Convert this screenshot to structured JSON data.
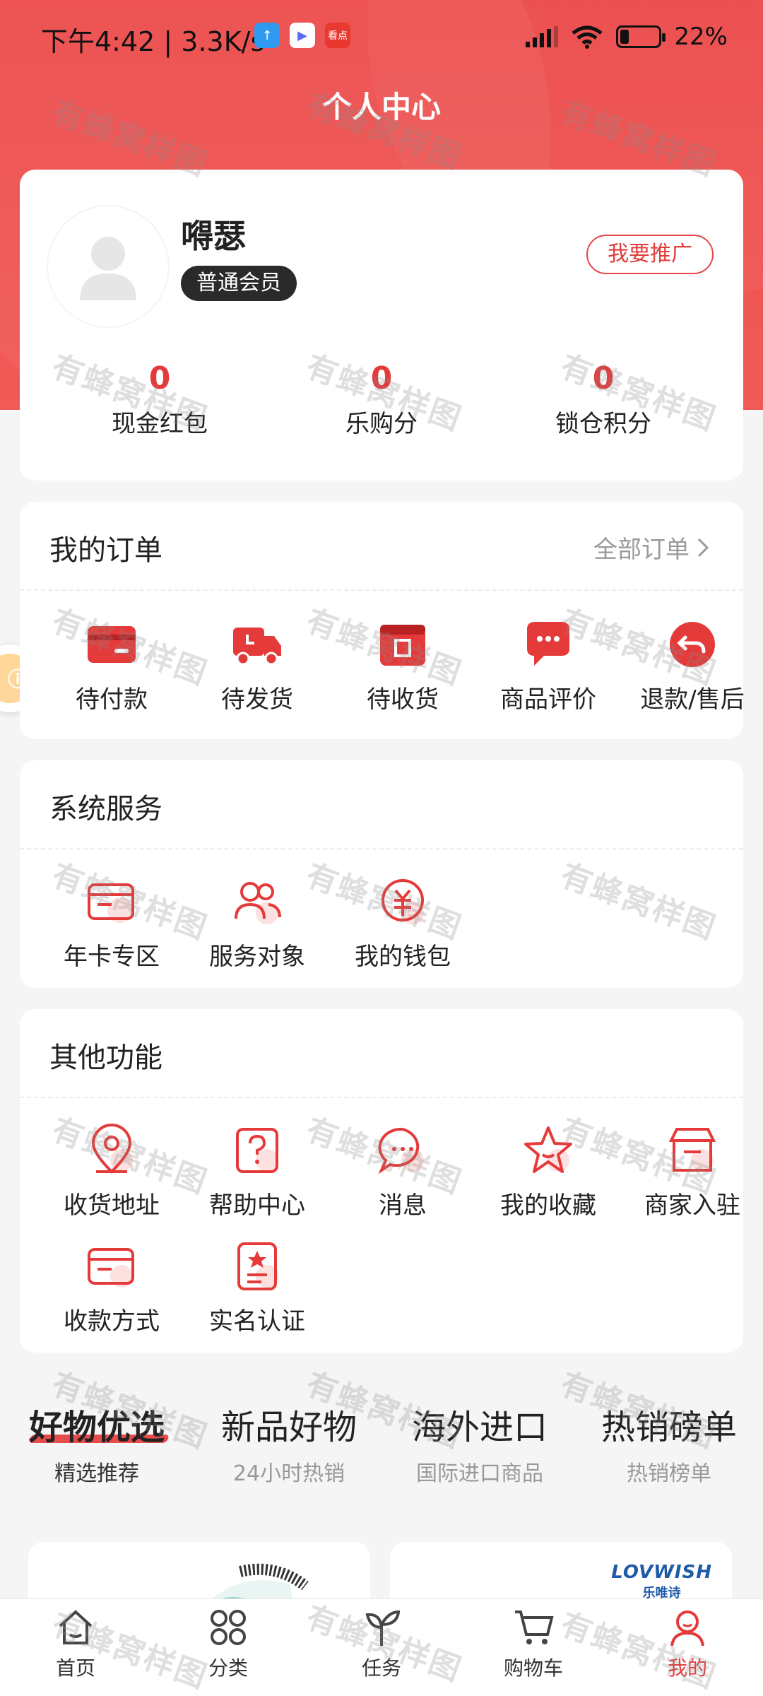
{
  "status_bar": {
    "time": "下午4:42 | 3.3K/s",
    "apps": [
      {
        "icon": "upload-app-icon",
        "color": "#2e9bf0",
        "glyph": "↑"
      },
      {
        "icon": "play-app-icon",
        "color": "#ffffff",
        "glyph": "▶"
      },
      {
        "icon": "news-app-icon",
        "color": "#e8382f",
        "glyph": "看点"
      }
    ],
    "battery": "22%"
  },
  "page": {
    "title": "个人中心"
  },
  "profile": {
    "name": "嘚瑟",
    "member_level": "普通会员",
    "promote_label": "我要推广",
    "stats": [
      {
        "value": "0",
        "label": "现金红包"
      },
      {
        "value": "0",
        "label": "乐购分"
      },
      {
        "value": "0",
        "label": "锁仓积分"
      }
    ]
  },
  "orders": {
    "title": "我的订单",
    "all_label": "全部订单",
    "items": [
      {
        "label": "待付款",
        "icon": "card-icon"
      },
      {
        "label": "待发货",
        "icon": "truck-icon"
      },
      {
        "label": "待收货",
        "icon": "box-icon"
      },
      {
        "label": "商品评价",
        "icon": "comment-icon"
      },
      {
        "label": "退款/售后",
        "icon": "return-icon"
      }
    ]
  },
  "services": {
    "title": "系统服务",
    "items": [
      {
        "label": "年卡专区",
        "icon": "annual-card-icon"
      },
      {
        "label": "服务对象",
        "icon": "users-icon"
      },
      {
        "label": "我的钱包",
        "icon": "wallet-icon"
      }
    ]
  },
  "other": {
    "title": "其他功能",
    "items": [
      {
        "label": "收货地址",
        "icon": "location-icon"
      },
      {
        "label": "帮助中心",
        "icon": "help-icon"
      },
      {
        "label": "消息",
        "icon": "message-icon"
      },
      {
        "label": "我的收藏",
        "icon": "star-icon"
      },
      {
        "label": "商家入驻",
        "icon": "store-icon"
      },
      {
        "label": "收款方式",
        "icon": "payment-card-icon"
      },
      {
        "label": "实名认证",
        "icon": "id-verify-icon"
      }
    ]
  },
  "recommend_tabs": [
    {
      "title": "好物优选",
      "subtitle": "精选推荐"
    },
    {
      "title": "新品好物",
      "subtitle": "24小时热销"
    },
    {
      "title": "海外进口",
      "subtitle": "国际进口商品"
    },
    {
      "title": "热销磅单",
      "subtitle": "热销榜单"
    }
  ],
  "product_brand": {
    "en": "LOVWISH",
    "zh": "乐唯诗"
  },
  "bottom_nav": [
    {
      "label": "首页",
      "icon": "home-icon"
    },
    {
      "label": "分类",
      "icon": "category-icon"
    },
    {
      "label": "任务",
      "icon": "task-icon"
    },
    {
      "label": "购物车",
      "icon": "cart-icon"
    },
    {
      "label": "我的",
      "icon": "profile-icon"
    }
  ],
  "watermark": "有蜂窝样图",
  "colors": {
    "primary": "#e53a3a",
    "header_bg": "#ec4a4a",
    "page_bg": "#f5f5f5"
  }
}
